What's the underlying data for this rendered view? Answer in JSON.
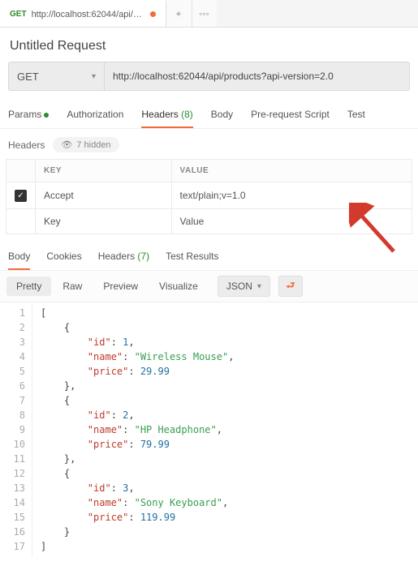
{
  "topTab": {
    "method": "GET",
    "title": "http://localhost:62044/api/prod..."
  },
  "requestTitle": "Untitled Request",
  "methodPicker": "GET",
  "url": "http://localhost:62044/api/products?api-version=2.0",
  "subTabs": {
    "params": "Params",
    "authorization": "Authorization",
    "headers": "Headers",
    "headersCount": "(8)",
    "body": "Body",
    "prerequest": "Pre-request Script",
    "tests": "Test"
  },
  "headersBar": {
    "title": "Headers",
    "hidden": "7 hidden"
  },
  "tableHead": {
    "key": "KEY",
    "value": "VALUE"
  },
  "headerRow": {
    "key": "Accept",
    "value": "text/plain;v=1.0"
  },
  "placeholders": {
    "key": "Key",
    "value": "Value"
  },
  "responseTabs": {
    "body": "Body",
    "cookies": "Cookies",
    "headers": "Headers",
    "headersCount": "(7)",
    "testResults": "Test Results"
  },
  "prettyBar": {
    "pretty": "Pretty",
    "raw": "Raw",
    "preview": "Preview",
    "visualize": "Visualize",
    "format": "JSON"
  },
  "codeLines": [
    "[",
    "    {",
    "        \"id\": 1,",
    "        \"name\": \"Wireless Mouse\",",
    "        \"price\": 29.99",
    "    },",
    "    {",
    "        \"id\": 2,",
    "        \"name\": \"HP Headphone\",",
    "        \"price\": 79.99",
    "    },",
    "    {",
    "        \"id\": 3,",
    "        \"name\": \"Sony Keyboard\",",
    "        \"price\": 119.99",
    "    }",
    "]"
  ]
}
